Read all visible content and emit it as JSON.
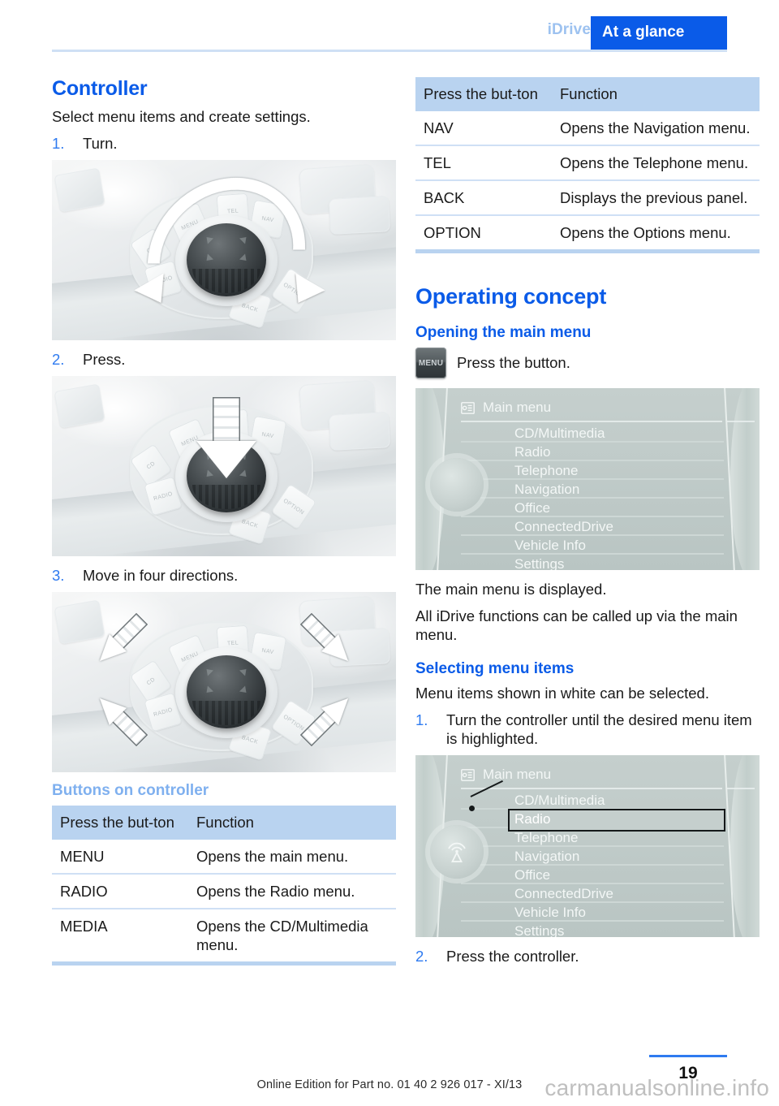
{
  "header": {
    "chapter": "iDrive",
    "section": "At a glance"
  },
  "left_column": {
    "controller_heading": "Controller",
    "controller_intro": "Select menu items and create settings.",
    "steps": [
      {
        "num": "1.",
        "text": "Turn."
      },
      {
        "num": "2.",
        "text": "Press."
      },
      {
        "num": "3.",
        "text": "Move in four directions."
      }
    ],
    "figures": [
      {
        "caption_key": "turn-controller-photo",
        "alt": "iDrive controller with rotation arrows"
      },
      {
        "caption_key": "press-controller-photo",
        "alt": "iDrive controller with press arrow"
      },
      {
        "caption_key": "move-controller-photo",
        "alt": "iDrive controller with four direction arrows"
      }
    ],
    "buttons_heading": "Buttons on controller",
    "buttons_table": {
      "headers": [
        "Press the but-­ton",
        "Function"
      ],
      "rows": [
        [
          "MENU",
          "Opens the main menu."
        ],
        [
          "RADIO",
          "Opens the Radio menu."
        ],
        [
          "MEDIA",
          "Opens the CD/Multimedia menu."
        ]
      ]
    }
  },
  "right_column": {
    "buttons_table": {
      "headers": [
        "Press the but-­ton",
        "Function"
      ],
      "rows": [
        [
          "NAV",
          "Opens the Navigation menu."
        ],
        [
          "TEL",
          "Opens the Telephone menu."
        ],
        [
          "BACK",
          "Displays the previous panel."
        ],
        [
          "OPTION",
          "Opens the Options menu."
        ]
      ]
    },
    "operating_concept_heading": "Operating concept",
    "opening_main_menu_heading": "Opening the main menu",
    "menu_button_label": "MENU",
    "press_button_text": "Press the button.",
    "screen_one": {
      "title": "Main menu",
      "items": [
        "CD/Multimedia",
        "Radio",
        "Telephone",
        "Navigation",
        "Office",
        "ConnectedDrive",
        "Vehicle Info",
        "Settings"
      ],
      "highlighted": null
    },
    "after_screen_paragraphs": [
      "The main menu is displayed.",
      "All iDrive functions can be called up via the main menu."
    ],
    "selecting_heading": "Selecting menu items",
    "selecting_intro": "Menu items shown in white can be selected.",
    "selecting_steps": [
      {
        "num": "1.",
        "text": "Turn the controller until the desired menu item is highlighted."
      },
      {
        "num": "2.",
        "text": "Press the controller."
      }
    ],
    "screen_two": {
      "title": "Main menu",
      "items": [
        "CD/Multimedia",
        "Radio",
        "Telephone",
        "Navigation",
        "Office",
        "ConnectedDrive",
        "Vehicle Info",
        "Settings"
      ],
      "highlighted": "Radio"
    }
  },
  "footer": {
    "edition": "Online Edition for Part no. 01 40 2 926 017 - XI/13",
    "page_number": "19",
    "watermark": "carmanualsonline.info"
  },
  "colors": {
    "accent_blue": "#0a5be8",
    "light_blue": "#7fb0ef",
    "table_header": "#b9d3f0",
    "rule_blue": "#cfe0f5",
    "screen_bg": "#c5cfcd"
  }
}
